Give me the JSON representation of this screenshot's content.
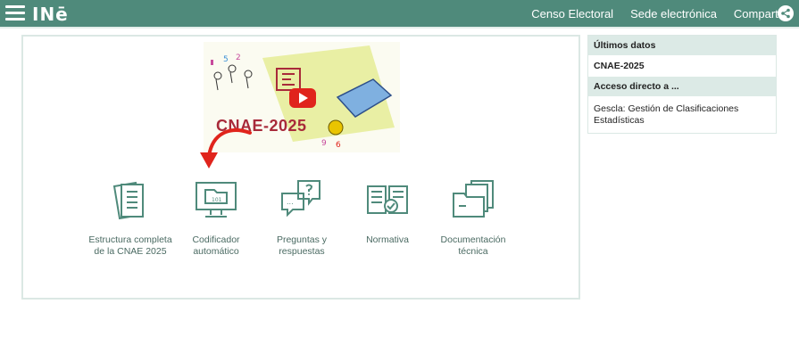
{
  "header": {
    "logo": "INē",
    "nav": [
      {
        "label": "Censo Electoral"
      },
      {
        "label": "Sede electrónica"
      },
      {
        "label": "Compartir"
      }
    ],
    "brand_color": "#4f8a7b"
  },
  "video": {
    "title": "CNAE-2025"
  },
  "tiles": [
    {
      "label": "Estructura completa de la CNAE 2025",
      "icon": "documents-icon"
    },
    {
      "label": "Codificador automático",
      "icon": "computer-folder-icon"
    },
    {
      "label": "Preguntas y respuestas",
      "icon": "question-chat-icon"
    },
    {
      "label": "Normativa",
      "icon": "book-check-icon"
    },
    {
      "label": "Documentación técnica",
      "icon": "folders-icon"
    }
  ],
  "sidebar": {
    "latest_heading": "Últimos datos",
    "latest_item": "CNAE-2025",
    "access_heading": "Acceso directo a ...",
    "access_item": "Gescla: Gestión de Clasificaciones Estadísticas"
  }
}
